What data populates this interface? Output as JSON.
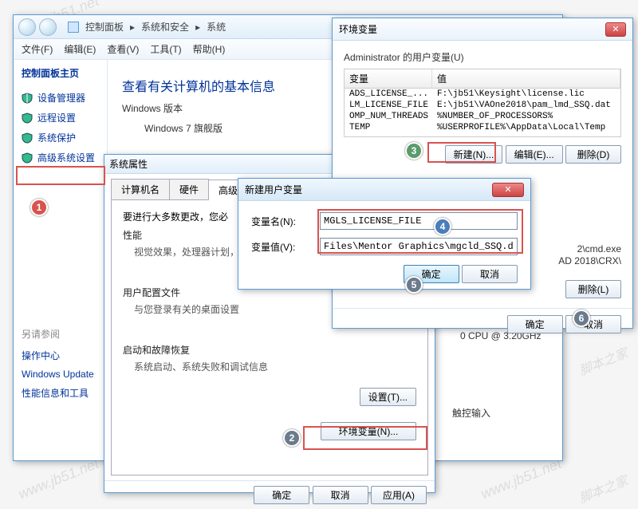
{
  "explorer": {
    "breadcrumb": [
      "控制面板",
      "系统和安全",
      "系统"
    ],
    "menu": [
      "文件(F)",
      "编辑(E)",
      "查看(V)",
      "工具(T)",
      "帮助(H)"
    ],
    "sidebar_title": "控制面板主页",
    "sidebar_items": [
      "设备管理器",
      "远程设置",
      "系统保护",
      "高级系统设置"
    ],
    "heading": "查看有关计算机的基本信息",
    "section": "Windows 版本",
    "os": "Windows 7 旗舰版",
    "see_also": "另请参阅",
    "links": [
      "操作中心",
      "Windows Update",
      "性能信息和工具"
    ],
    "cpu_text": "0 CPU @ 3.20GHz",
    "touch": "触控输入"
  },
  "sysprops": {
    "title": "系统属性",
    "tabs": [
      "计算机名",
      "硬件",
      "高级"
    ],
    "tabs_active": 2,
    "hint": "要进行大多数更改，您必",
    "perf_title": "性能",
    "perf_desc": "视觉效果，处理器计划，",
    "profiles_title": "用户配置文件",
    "profiles_desc": "与您登录有关的桌面设置",
    "startup_title": "启动和故障恢复",
    "startup_desc": "系统启动、系统失败和调试信息",
    "settings_btn": "设置(T)...",
    "envvar_btn": "环境变量(N)...",
    "ok": "确定",
    "cancel": "取消",
    "apply": "应用(A)"
  },
  "envvars": {
    "title": "环境变量",
    "user_group": "Administrator 的用户变量(U)",
    "cols": [
      "变量",
      "值"
    ],
    "rows": [
      {
        "name": "ADS_LICENSE_...",
        "val": "F:\\jb51\\Keysight\\license.lic"
      },
      {
        "name": "LM_LICENSE_FILE",
        "val": "E:\\jb51\\VAOne2018\\pam_lmd_SSQ.dat"
      },
      {
        "name": "OMP_NUM_THREADS",
        "val": "%NUMBER_OF_PROCESSORS%"
      },
      {
        "name": "TEMP",
        "val": "%USERPROFILE%\\AppData\\Local\\Temp"
      }
    ],
    "new_btn": "新建(N)...",
    "edit_btn": "编辑(E)...",
    "del_btn": "删除(D)",
    "del_btn2": "删除(L)",
    "sys_rows": [
      {
        "val2": "2\\cmd.exe"
      },
      {
        "val2": "AD 2018\\CRX\\"
      }
    ],
    "ok": "确定",
    "cancel": "取消"
  },
  "newvar": {
    "title": "新建用户变量",
    "name_label": "变量名(N):",
    "value_label": "变量值(V):",
    "name_value": "MGLS_LICENSE_FILE",
    "value_value": "Files\\Mentor Graphics\\mgcld_SSQ.dat",
    "ok": "确定",
    "cancel": "取消"
  },
  "watermark": "www.jb51.net",
  "site": "脚本之家"
}
